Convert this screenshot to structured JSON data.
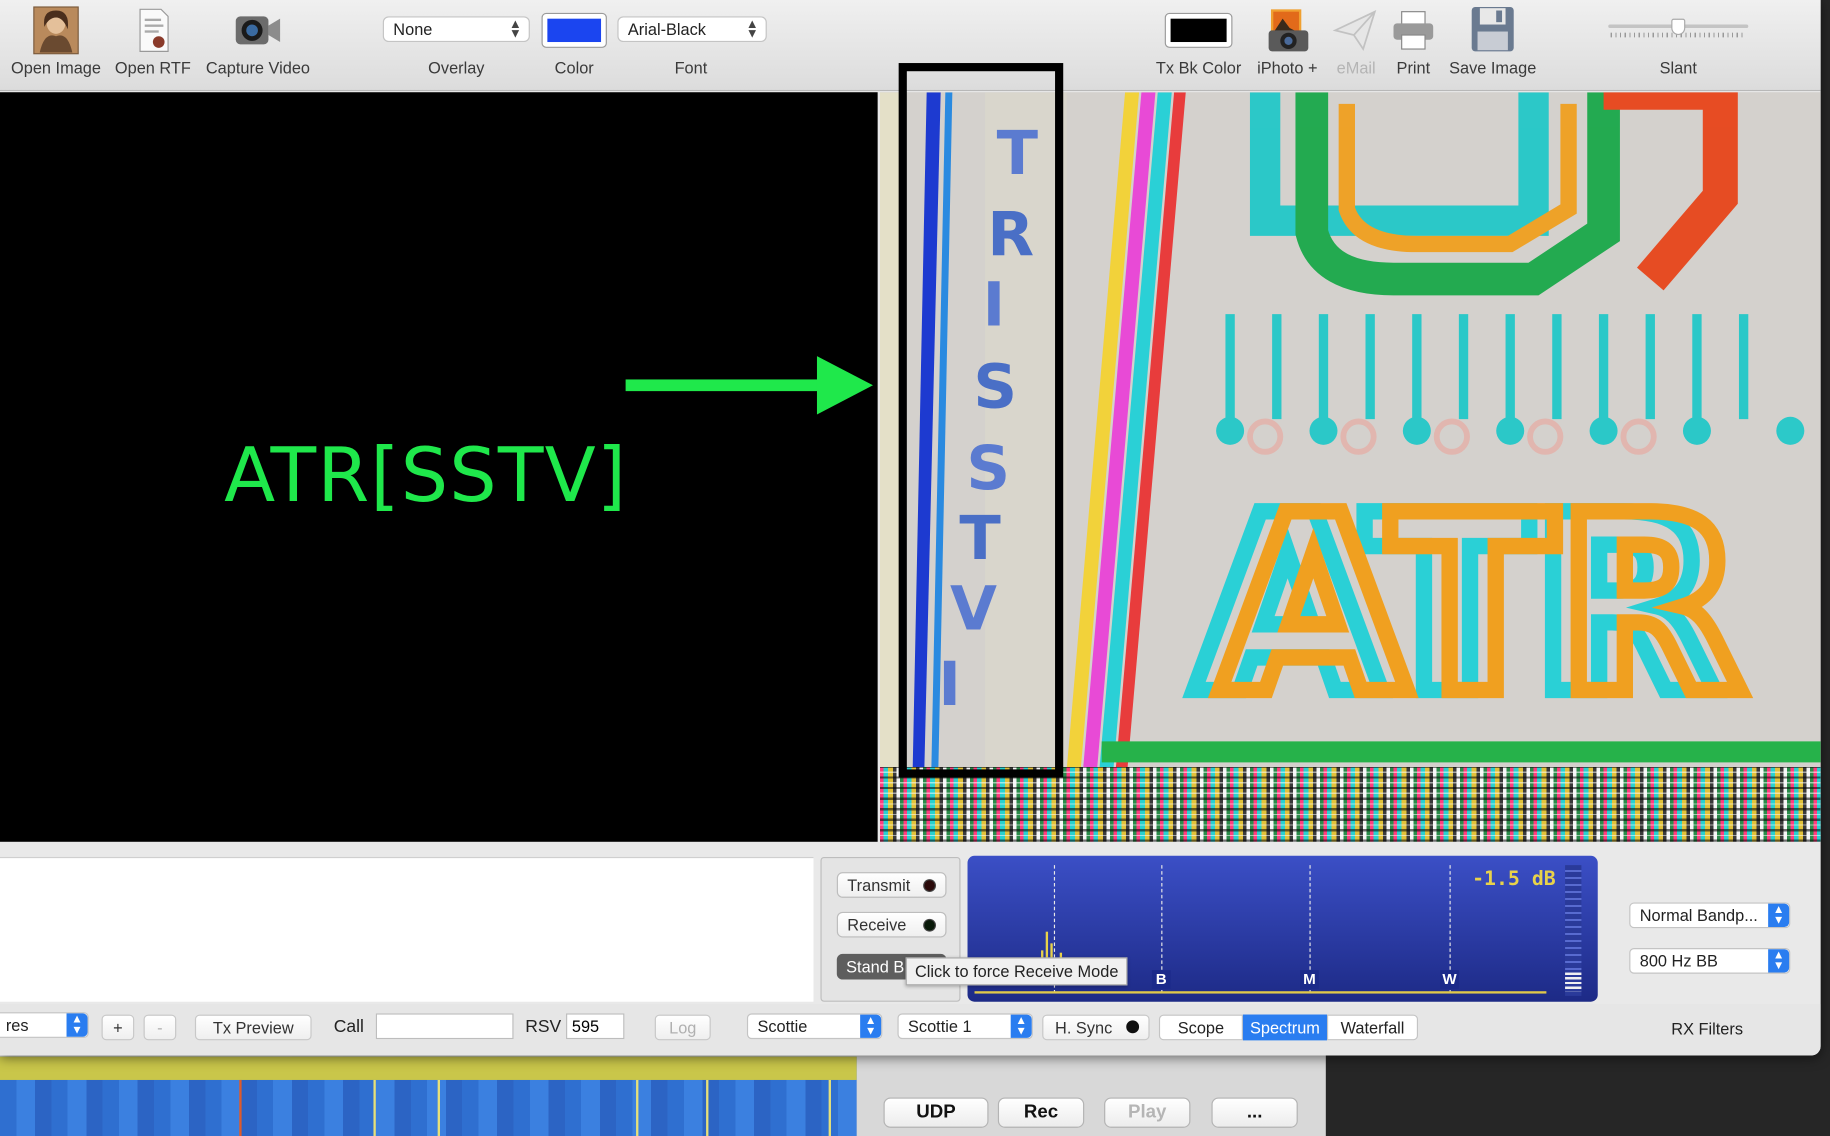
{
  "toolbar": {
    "open_image": "Open Image",
    "open_rtf": "Open RTF",
    "capture_video": "Capture Video",
    "overlay_value": "None",
    "overlay_label": "Overlay",
    "color_label": "Color",
    "color_value": "#1b45f0",
    "font_value": "Arial-Black",
    "font_label": "Font",
    "tx_bk_color_label": "Tx Bk Color",
    "tx_bk_color_value": "#000000",
    "iphoto_label": "iPhoto +",
    "email_label": "eMail",
    "print_label": "Print",
    "save_image_label": "Save Image",
    "slant_label": "Slant",
    "slant_level_percent": 50
  },
  "image": {
    "annotation_text": "ATR[SSTV]",
    "annotation_color": "#1fe84b",
    "vertical_text": "TRISSTV",
    "received_text": "ATR"
  },
  "mode_buttons": {
    "transmit": "Transmit",
    "receive": "Receive",
    "standby": "Stand B",
    "tooltip": "Click to force Receive Mode"
  },
  "spectrum": {
    "level": "-1.5 dB",
    "markers": [
      "B",
      "M",
      "W"
    ]
  },
  "rx_filters": {
    "bandpass": "Normal Bandp...",
    "bb": "800 Hz BB",
    "label": "RX Filters"
  },
  "bottom_bar": {
    "pictures_select": "res",
    "plus": "+",
    "minus": "-",
    "tx_preview": "Tx Preview",
    "call_label": "Call",
    "call_value": "",
    "rsv_label": "RSV",
    "rsv_value": "595",
    "log": "Log",
    "family_select": "Scottie",
    "mode_select": "Scottie 1",
    "hsync": "H. Sync",
    "scope": "Scope",
    "spectrum_tab": "Spectrum",
    "waterfall_tab": "Waterfall"
  },
  "back_window": {
    "udp": "UDP",
    "rec": "Rec",
    "play": "Play",
    "more": "..."
  }
}
